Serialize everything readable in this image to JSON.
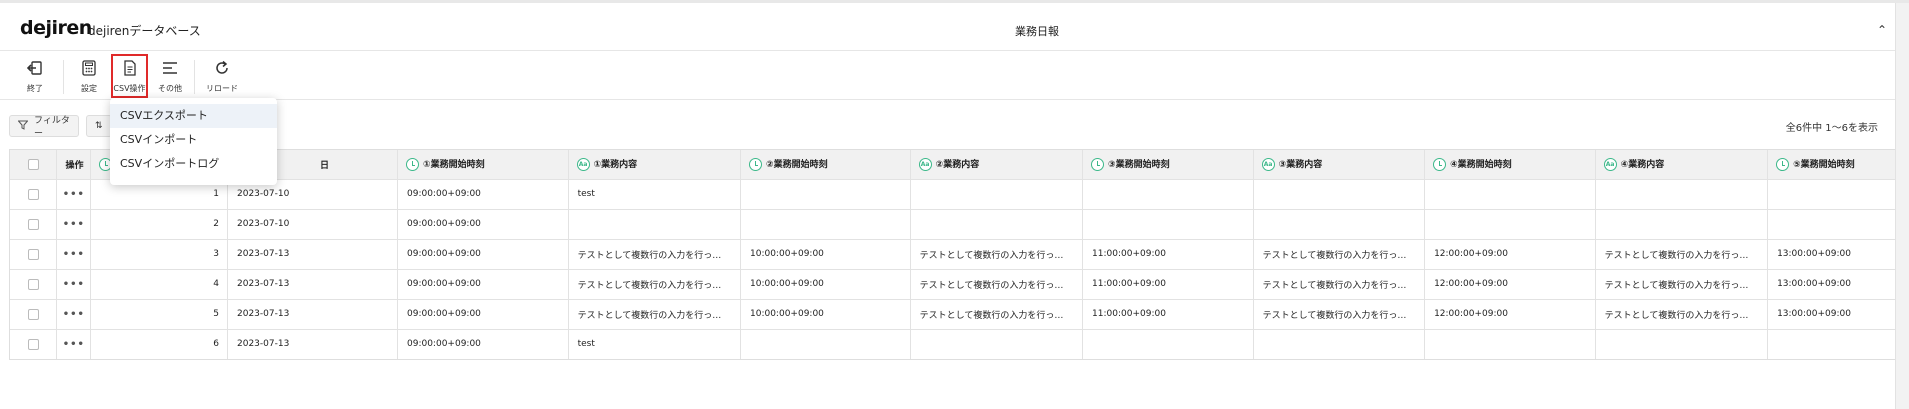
{
  "header": {
    "logo": "dejiren",
    "db_name": "dejirenデータベース",
    "page_title": "業務日報",
    "collapse_glyph": "⌃"
  },
  "toolbar": {
    "exit_label": "終了",
    "settings_label": "設定",
    "csv_label": "CSV操作",
    "other_label": "その他",
    "reload_label": "リロード"
  },
  "filter_bar": {
    "filter_label": "フィルター",
    "sort_glyph": "⇅",
    "count_text": "全6件中 1〜6を表示"
  },
  "csv_menu": {
    "items": [
      "CSVエクスポート",
      "CSVインポート",
      "CSVインポートログ"
    ],
    "highlighted_index": 0
  },
  "table": {
    "ops_header": "操作",
    "columns": [
      {
        "label": "",
        "icon": "clock-icon"
      },
      {
        "label": "日",
        "icon": ""
      },
      {
        "label": "①業務開始時刻",
        "icon": "clock-icon"
      },
      {
        "label": "①業務内容",
        "icon": "text-icon"
      },
      {
        "label": "②業務開始時刻",
        "icon": "clock-icon"
      },
      {
        "label": "②業務内容",
        "icon": "text-icon"
      },
      {
        "label": "③業務開始時刻",
        "icon": "clock-icon"
      },
      {
        "label": "③業務内容",
        "icon": "text-icon"
      },
      {
        "label": "④業務開始時刻",
        "icon": "clock-icon"
      },
      {
        "label": "④業務内容",
        "icon": "text-icon"
      },
      {
        "label": "⑤業務開始時刻",
        "icon": "clock-icon"
      }
    ],
    "ops_glyph": "•••",
    "rows": [
      [
        "1",
        "2023-07-10",
        "09:00:00+09:00",
        "test",
        "",
        "",
        "",
        "",
        "",
        "",
        ""
      ],
      [
        "2",
        "2023-07-10",
        "09:00:00+09:00",
        "",
        "",
        "",
        "",
        "",
        "",
        "",
        ""
      ],
      [
        "3",
        "2023-07-13",
        "09:00:00+09:00",
        "テストとして複数行の入力を行っ…",
        "10:00:00+09:00",
        "テストとして複数行の入力を行っ…",
        "11:00:00+09:00",
        "テストとして複数行の入力を行っ…",
        "12:00:00+09:00",
        "テストとして複数行の入力を行っ…",
        "13:00:00+09:00"
      ],
      [
        "4",
        "2023-07-13",
        "09:00:00+09:00",
        "テストとして複数行の入力を行っ…",
        "10:00:00+09:00",
        "テストとして複数行の入力を行っ…",
        "11:00:00+09:00",
        "テストとして複数行の入力を行っ…",
        "12:00:00+09:00",
        "テストとして複数行の入力を行っ…",
        "13:00:00+09:00"
      ],
      [
        "5",
        "2023-07-13",
        "09:00:00+09:00",
        "テストとして複数行の入力を行っ…",
        "10:00:00+09:00",
        "テストとして複数行の入力を行っ…",
        "11:00:00+09:00",
        "テストとして複数行の入力を行っ…",
        "12:00:00+09:00",
        "テストとして複数行の入力を行っ…",
        "13:00:00+09:00"
      ],
      [
        "6",
        "2023-07-13",
        "09:00:00+09:00",
        "test",
        "",
        "",
        "",
        "",
        "",
        "",
        ""
      ]
    ]
  },
  "colors": {
    "accent_green": "#3cb88a",
    "highlight_red": "#e02a2a"
  }
}
